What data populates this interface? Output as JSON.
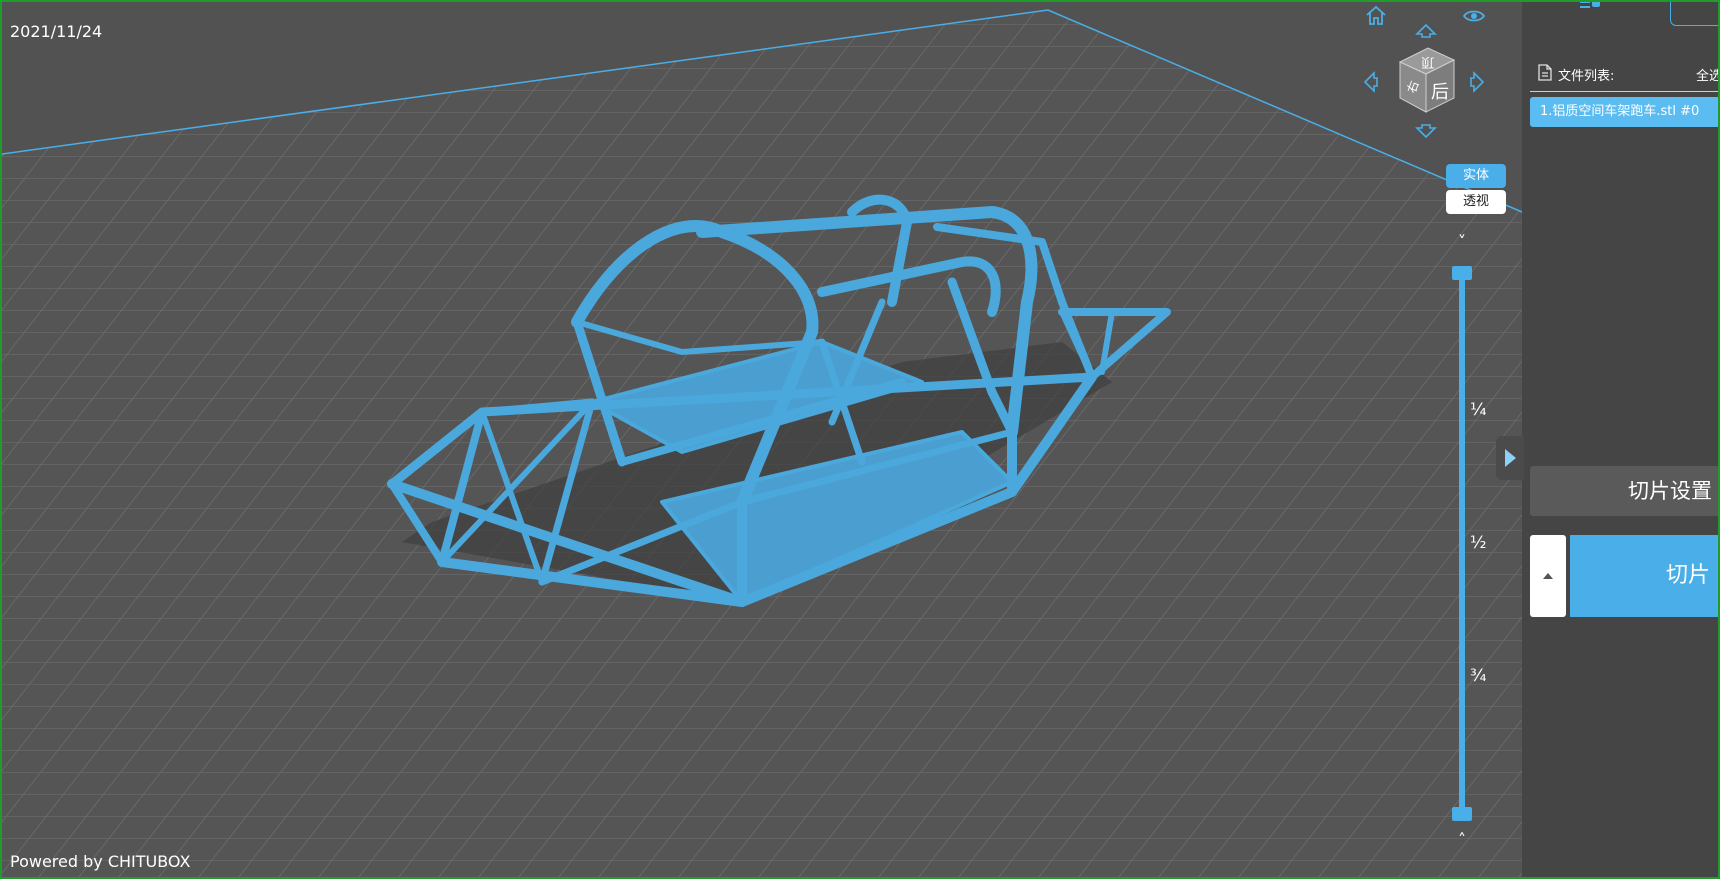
{
  "viewport": {
    "date": "2021/11/24",
    "powered_by": "Powered by CHITUBOX",
    "model_color": "#4aa8dc",
    "grid_color": "#6a6a6a",
    "bg_color": "#525252"
  },
  "nav_cube": {
    "face_top": "顶",
    "face_front": "后",
    "face_side": "右",
    "icons": [
      "home-icon",
      "eye-icon",
      "arrow-up-icon",
      "arrow-left-icon",
      "arrow-right-icon",
      "arrow-down-icon"
    ]
  },
  "render_modes": {
    "solid": "实体",
    "transparent": "透视"
  },
  "layer_slider": {
    "marks": [
      "¼",
      "½",
      "¾"
    ],
    "up_chevron": "˄",
    "down_chevron": "˅"
  },
  "panel": {
    "file_list_label": "文件列表:",
    "select_all": "全选",
    "files": [
      "1.铝质空间车架跑车.stl #0"
    ],
    "slice_settings": "切片设置",
    "slice": "切片",
    "accent": "#4aaee8"
  }
}
